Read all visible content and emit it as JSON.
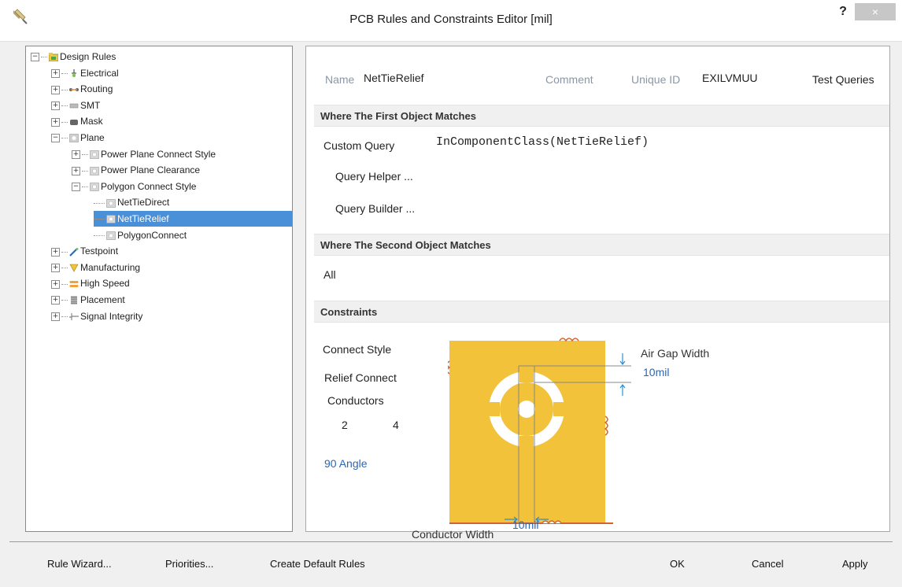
{
  "window": {
    "title": "PCB Rules and Constraints Editor [mil]",
    "help_label": "?",
    "close_label": "×"
  },
  "tree": {
    "root": "Design Rules",
    "items": [
      {
        "label": "Electrical",
        "level": 1,
        "expander": "+",
        "icon": "electrical-icon"
      },
      {
        "label": "Routing",
        "level": 1,
        "expander": "+",
        "icon": "routing-icon"
      },
      {
        "label": "SMT",
        "level": 1,
        "expander": "+",
        "icon": "smt-icon"
      },
      {
        "label": "Mask",
        "level": 1,
        "expander": "+",
        "icon": "mask-icon"
      },
      {
        "label": "Plane",
        "level": 1,
        "expander": "−",
        "icon": "plane-icon"
      },
      {
        "label": "Power Plane Connect Style",
        "level": 2,
        "expander": "+",
        "icon": "rule-icon"
      },
      {
        "label": "Power Plane Clearance",
        "level": 2,
        "expander": "+",
        "icon": "rule-icon"
      },
      {
        "label": "Polygon Connect Style",
        "level": 2,
        "expander": "−",
        "icon": "rule-icon"
      },
      {
        "label": "NetTieDirect",
        "level": 3,
        "expander": "",
        "icon": "rule-icon"
      },
      {
        "label": "NetTieRelief",
        "level": 3,
        "expander": "",
        "icon": "rule-icon",
        "selected": true
      },
      {
        "label": "PolygonConnect",
        "level": 3,
        "expander": "",
        "icon": "rule-icon"
      },
      {
        "label": "Testpoint",
        "level": 1,
        "expander": "+",
        "icon": "testpoint-icon"
      },
      {
        "label": "Manufacturing",
        "level": 1,
        "expander": "+",
        "icon": "manufacturing-icon"
      },
      {
        "label": "High Speed",
        "level": 1,
        "expander": "+",
        "icon": "high-speed-icon"
      },
      {
        "label": "Placement",
        "level": 1,
        "expander": "+",
        "icon": "placement-icon"
      },
      {
        "label": "Signal Integrity",
        "level": 1,
        "expander": "+",
        "icon": "signal-integrity-icon"
      }
    ]
  },
  "rule": {
    "name_label": "Name",
    "name_value": "NetTieRelief",
    "comment_label": "Comment",
    "unique_id_label": "Unique ID",
    "unique_id_value": "EXILVMUU",
    "test_queries_label": "Test Queries"
  },
  "first_match": {
    "header": "Where The First Object Matches",
    "custom_query_label": "Custom Query",
    "query_text": "InComponentClass(NetTieRelief)",
    "query_helper_label": "Query Helper ...",
    "query_builder_label": "Query Builder ..."
  },
  "second_match": {
    "header": "Where The Second Object Matches",
    "value": "All"
  },
  "constraints": {
    "header": "Constraints",
    "connect_style_label": "Connect Style",
    "connect_style_value": "Relief Connect",
    "conductors_label": "Conductors",
    "conductors_options": [
      "2",
      "4"
    ],
    "angle_value": "90 Angle",
    "air_gap_label": "Air Gap Width",
    "air_gap_value": "10mil",
    "conductor_width_label": "Conductor Width",
    "conductor_width_value": "10mil",
    "colors": {
      "copper": "#f2c23a",
      "copper_edge": "#d4642a",
      "dimension": "#2b8fd6"
    }
  },
  "buttons": {
    "rule_wizard": "Rule Wizard...",
    "priorities": "Priorities...",
    "create_default": "Create Default Rules",
    "ok": "OK",
    "cancel": "Cancel",
    "apply": "Apply"
  }
}
